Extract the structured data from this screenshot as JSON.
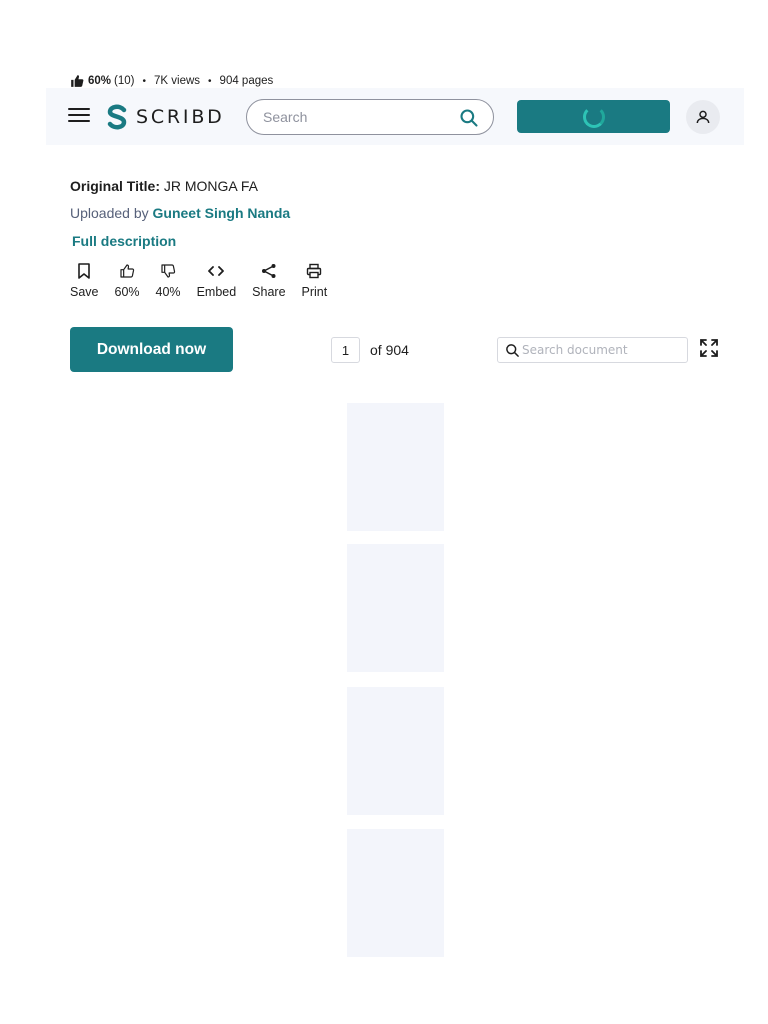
{
  "stats": {
    "rating_pct": "60%",
    "rating_count": "(10)",
    "views": "7K views",
    "pages": "904 pages"
  },
  "header": {
    "logo_text": "SCRIBD",
    "search_placeholder": "Search"
  },
  "document": {
    "original_title_label": "Original Title:",
    "original_title": "JR MONGA FA",
    "uploaded_by_label": "Uploaded by",
    "uploader": "Guneet Singh Nanda",
    "full_description": "Full description"
  },
  "actions": [
    {
      "label": "Save",
      "icon": "bookmark-icon"
    },
    {
      "label": "60%",
      "icon": "thumbs-up-icon"
    },
    {
      "label": "40%",
      "icon": "thumbs-down-icon"
    },
    {
      "label": "Embed",
      "icon": "code-icon"
    },
    {
      "label": "Share",
      "icon": "share-icon"
    },
    {
      "label": "Print",
      "icon": "print-icon"
    }
  ],
  "toolbar": {
    "download_label": "Download now",
    "current_page": "1",
    "of_pages": "of 904",
    "doc_search_placeholder": "Search document"
  },
  "colors": {
    "accent": "#1a7a82",
    "header_bg": "#f6f8fc",
    "page_placeholder": "#f3f5fb"
  }
}
